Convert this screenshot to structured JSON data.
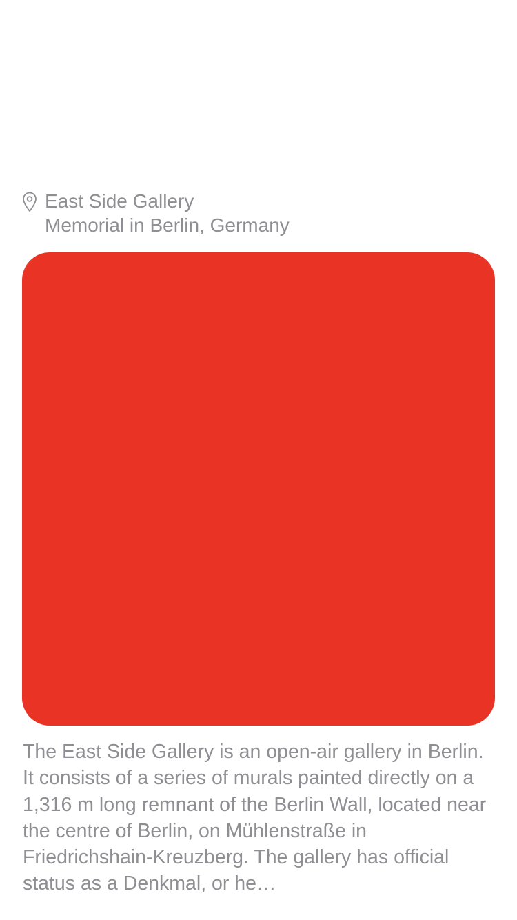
{
  "location": {
    "icon": "location-pin-icon",
    "title": "East Side Gallery",
    "subtitle": "Memorial in Berlin, Germany"
  },
  "media": {
    "color": "#e93325"
  },
  "description": "The East Side Gallery is an open-air gallery in Berlin. It consists of a series of murals painted directly on a 1,316 m long remnant of the Berlin Wall, located near the centre of Berlin, on Mühlenstraße in Friedrichshain-Kreuzberg. The gallery has official status as a Denkmal, or he…"
}
